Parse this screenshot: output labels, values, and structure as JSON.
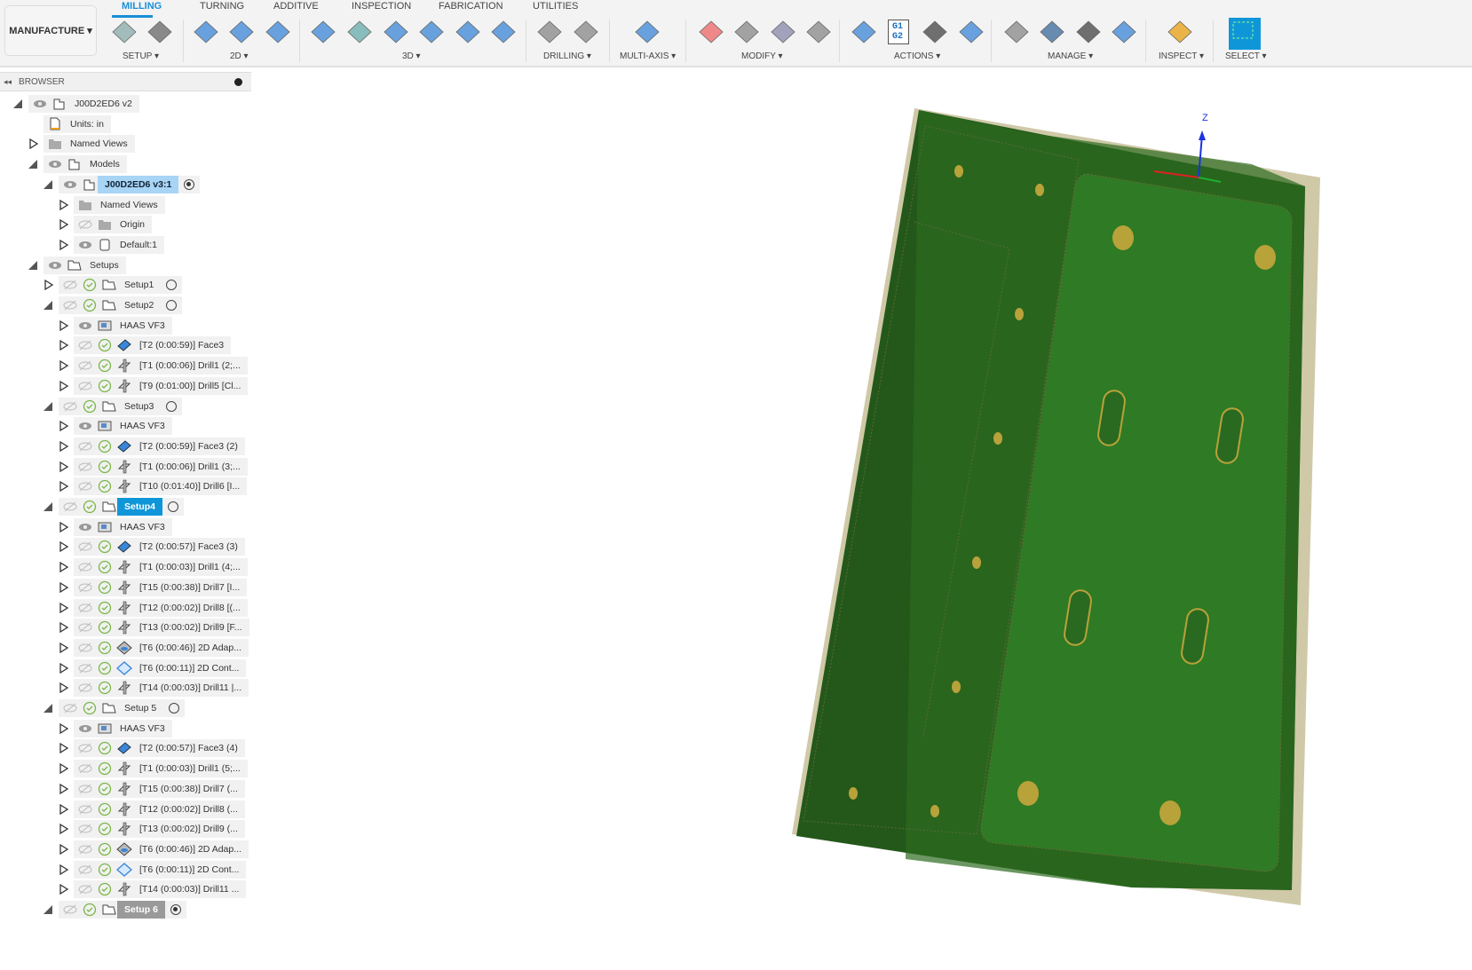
{
  "workspace": "MANUFACTURE",
  "tabs": [
    {
      "label": "MILLING",
      "active": true
    },
    {
      "label": "TURNING"
    },
    {
      "label": "ADDITIVE"
    },
    {
      "label": "INSPECTION"
    },
    {
      "label": "FABRICATION"
    },
    {
      "label": "UTILITIES"
    }
  ],
  "groups": [
    "SETUP ▾",
    "2D ▾",
    "3D ▾",
    "DRILLING ▾",
    "MULTI-AXIS ▾",
    "MODIFY ▾",
    "ACTIONS ▾",
    "MANAGE ▾",
    "INSPECT ▾",
    "SELECT ▾"
  ],
  "actions_g1g2": "G1 G2",
  "browser": {
    "title": "BROWSER"
  },
  "tree": [
    {
      "lv": 0,
      "t": "e",
      "eye": "on",
      "icon": "component",
      "label": "J00D2ED6 v2"
    },
    {
      "lv": 1,
      "t": "",
      "icon": "units",
      "label": "Units: in"
    },
    {
      "lv": 1,
      "t": "c",
      "icon": "folder",
      "label": "Named Views"
    },
    {
      "lv": 1,
      "t": "e",
      "eye": "on",
      "icon": "component",
      "label": "Models"
    },
    {
      "lv": 2,
      "t": "e",
      "eye": "on",
      "icon": "component",
      "label": "J00D2ED6 v3:1",
      "style": "hl",
      "radio": "on"
    },
    {
      "lv": 3,
      "t": "c",
      "icon": "folder",
      "label": "Named Views"
    },
    {
      "lv": 3,
      "t": "c",
      "eye": "off",
      "icon": "folder",
      "label": "Origin"
    },
    {
      "lv": 3,
      "t": "c",
      "eye": "on",
      "icon": "body",
      "label": "Default:1"
    },
    {
      "lv": 1,
      "t": "e",
      "eye": "on",
      "icon": "setups",
      "label": "Setups"
    },
    {
      "lv": 2,
      "t": "c",
      "eye": "off",
      "check": true,
      "icon": "setup",
      "label": "Setup1",
      "radio": "off"
    },
    {
      "lv": 2,
      "t": "e",
      "eye": "off",
      "check": true,
      "icon": "setup",
      "label": "Setup2",
      "radio": "off"
    },
    {
      "lv": 3,
      "t": "c",
      "eye": "on",
      "icon": "machine",
      "label": "HAAS VF3"
    },
    {
      "lv": 3,
      "t": "c",
      "eye": "off",
      "check": true,
      "icon": "face",
      "label": "[T2 (0:00:59)] Face3"
    },
    {
      "lv": 3,
      "t": "c",
      "eye": "off",
      "check": true,
      "icon": "drill",
      "label": "[T1 (0:00:06)] Drill1 (2;..."
    },
    {
      "lv": 3,
      "t": "c",
      "eye": "off",
      "check": true,
      "icon": "drill",
      "label": "[T9 (0:01:00)] Drill5 [Cl..."
    },
    {
      "lv": 2,
      "t": "e",
      "eye": "off",
      "check": true,
      "icon": "setup",
      "label": "Setup3",
      "radio": "off"
    },
    {
      "lv": 3,
      "t": "c",
      "eye": "on",
      "icon": "machine",
      "label": "HAAS VF3"
    },
    {
      "lv": 3,
      "t": "c",
      "eye": "off",
      "check": true,
      "icon": "face",
      "label": "[T2 (0:00:59)] Face3 (2)"
    },
    {
      "lv": 3,
      "t": "c",
      "eye": "off",
      "check": true,
      "icon": "drill",
      "label": "[T1 (0:00:06)] Drill1 (3;..."
    },
    {
      "lv": 3,
      "t": "c",
      "eye": "off",
      "check": true,
      "icon": "drill",
      "label": "[T10 (0:01:40)] Drill6 [I..."
    },
    {
      "lv": 2,
      "t": "e",
      "eye": "off",
      "check": true,
      "icon": "setup",
      "label": "Setup4",
      "style": "sel",
      "radio": "off"
    },
    {
      "lv": 3,
      "t": "c",
      "eye": "on",
      "icon": "machine",
      "label": "HAAS VF3"
    },
    {
      "lv": 3,
      "t": "c",
      "eye": "off",
      "check": true,
      "icon": "face",
      "label": "[T2 (0:00:57)] Face3 (3)"
    },
    {
      "lv": 3,
      "t": "c",
      "eye": "off",
      "check": true,
      "icon": "drill",
      "label": "[T1 (0:00:03)] Drill1 (4;..."
    },
    {
      "lv": 3,
      "t": "c",
      "eye": "off",
      "check": true,
      "icon": "drill",
      "label": "[T15 (0:00:38)] Drill7 [I..."
    },
    {
      "lv": 3,
      "t": "c",
      "eye": "off",
      "check": true,
      "icon": "drill",
      "label": "[T12 (0:00:02)] Drill8 [(..."
    },
    {
      "lv": 3,
      "t": "c",
      "eye": "off",
      "check": true,
      "icon": "drill",
      "label": "[T13 (0:00:02)] Drill9 [F..."
    },
    {
      "lv": 3,
      "t": "c",
      "eye": "off",
      "check": true,
      "icon": "adaptive",
      "label": "[T6 (0:00:46)] 2D Adap..."
    },
    {
      "lv": 3,
      "t": "c",
      "eye": "off",
      "check": true,
      "icon": "contour",
      "label": "[T6 (0:00:11)] 2D Cont..."
    },
    {
      "lv": 3,
      "t": "c",
      "eye": "off",
      "check": true,
      "icon": "drill",
      "label": "[T14 (0:00:03)] Drill11 |..."
    },
    {
      "lv": 2,
      "t": "e",
      "eye": "off",
      "check": true,
      "icon": "setup",
      "label": "Setup 5",
      "radio": "off"
    },
    {
      "lv": 3,
      "t": "c",
      "eye": "on",
      "icon": "machine",
      "label": "HAAS VF3"
    },
    {
      "lv": 3,
      "t": "c",
      "eye": "off",
      "check": true,
      "icon": "face",
      "label": "[T2 (0:00:57)] Face3 (4)"
    },
    {
      "lv": 3,
      "t": "c",
      "eye": "off",
      "check": true,
      "icon": "drill",
      "label": "[T1 (0:00:03)] Drill1 (5;..."
    },
    {
      "lv": 3,
      "t": "c",
      "eye": "off",
      "check": true,
      "icon": "drill",
      "label": "[T15 (0:00:38)] Drill7 (..."
    },
    {
      "lv": 3,
      "t": "c",
      "eye": "off",
      "check": true,
      "icon": "drill",
      "label": "[T12 (0:00:02)] Drill8 (..."
    },
    {
      "lv": 3,
      "t": "c",
      "eye": "off",
      "check": true,
      "icon": "drill",
      "label": "[T13 (0:00:02)] Drill9 (..."
    },
    {
      "lv": 3,
      "t": "c",
      "eye": "off",
      "check": true,
      "icon": "adaptive",
      "label": "[T6 (0:00:46)] 2D Adap..."
    },
    {
      "lv": 3,
      "t": "c",
      "eye": "off",
      "check": true,
      "icon": "contour",
      "label": "[T6 (0:00:11)] 2D Cont..."
    },
    {
      "lv": 3,
      "t": "c",
      "eye": "off",
      "check": true,
      "icon": "drill",
      "label": "[T14 (0:00:03)] Drill11 ..."
    },
    {
      "lv": 2,
      "t": "e",
      "eye": "off",
      "check": true,
      "icon": "setup",
      "label": "Setup 6",
      "style": "grey",
      "radio": "on"
    }
  ],
  "viewport": {
    "axis_z": "Z",
    "part_color": "#24581a",
    "stock_color": "#cfc9a8"
  }
}
